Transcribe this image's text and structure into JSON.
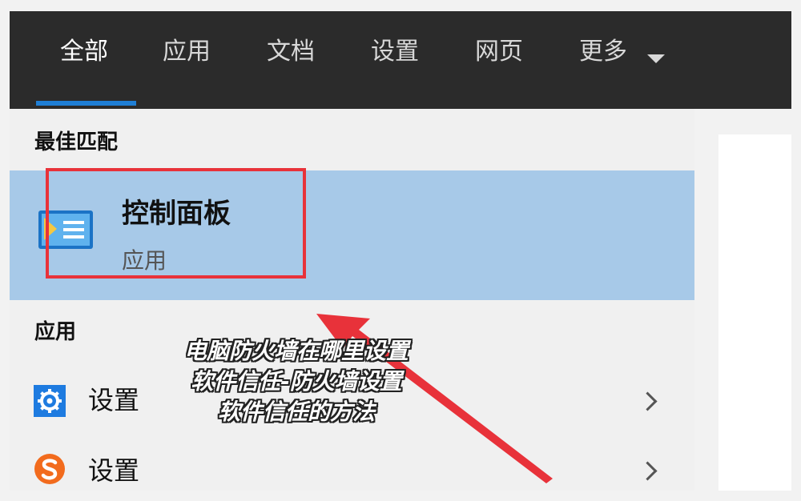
{
  "tabs": [
    {
      "label": "全部",
      "active": true
    },
    {
      "label": "应用",
      "active": false
    },
    {
      "label": "文档",
      "active": false
    },
    {
      "label": "设置",
      "active": false
    },
    {
      "label": "网页",
      "active": false
    },
    {
      "label": "更多",
      "active": false
    }
  ],
  "best_match": {
    "section_label": "最佳匹配",
    "title": "控制面板",
    "subtitle": "应用"
  },
  "apps": {
    "section_label": "应用",
    "items": [
      {
        "label": "设置",
        "icon": "gear-icon"
      },
      {
        "label": "设置",
        "icon": "sogou-icon"
      }
    ]
  },
  "caption": {
    "lines": [
      "电脑防火墙在哪里设置",
      "软件信任-防火墙设置",
      "软件信任的方法"
    ]
  },
  "colors": {
    "tabbar_bg": "#2b2b2b",
    "active_underline": "#1f7fd6",
    "selected_row": "#a7c9e8",
    "annotation_red": "#e8323a",
    "gear_blue": "#1e7be0",
    "sogou_orange": "#f26b1d"
  }
}
